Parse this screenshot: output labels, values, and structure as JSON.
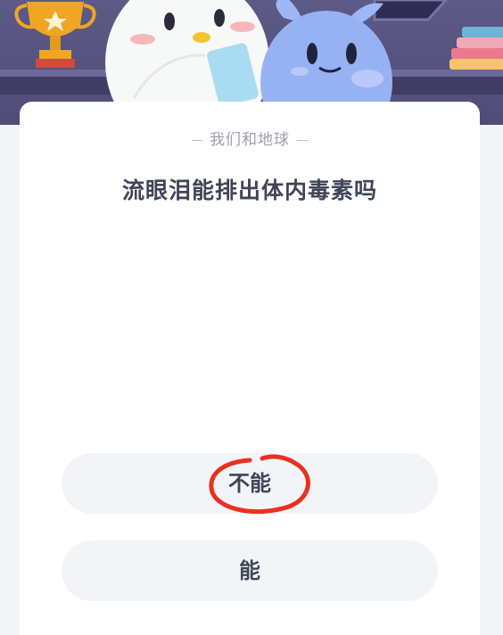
{
  "quiz": {
    "category": "我们和地球",
    "question": "流眼泪能排出体内毒素吗",
    "options": [
      {
        "label": "不能",
        "marked": true
      },
      {
        "label": "能",
        "marked": false
      }
    ]
  },
  "colors": {
    "banner": "#55527f",
    "card": "#ffffff",
    "option_bg": "#f2f4f8",
    "question_text": "#3f4557",
    "category_text": "#9aa0ad",
    "mark": "#e8321e"
  }
}
